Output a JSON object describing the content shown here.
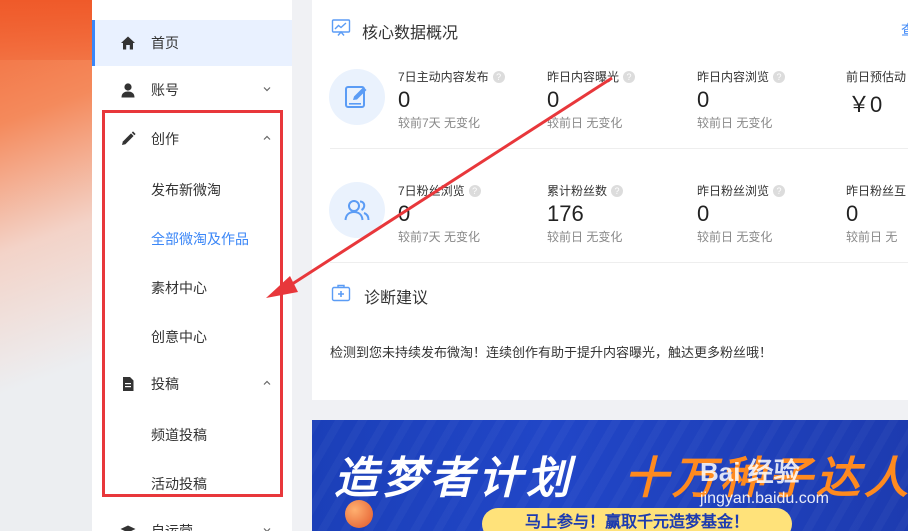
{
  "sidebar": {
    "items": [
      {
        "label": "首页",
        "icon": "home-icon",
        "active": true
      },
      {
        "label": "账号",
        "icon": "user-icon",
        "chevron": "down"
      },
      {
        "label": "创作",
        "icon": "pencil-icon",
        "chevron": "up"
      },
      {
        "label": "投稿",
        "icon": "document-icon",
        "chevron": "up"
      },
      {
        "label": "自运营",
        "icon": "graduation-cap-icon",
        "chevron": "down"
      }
    ],
    "create_sub": [
      "发布新微淘",
      "全部微淘及作品",
      "素材中心",
      "创意中心"
    ],
    "contribute_sub": [
      "频道投稿",
      "活动投稿"
    ],
    "selected_sub": "全部微淘及作品"
  },
  "core": {
    "title": "核心数据概况",
    "more": "查",
    "row1": [
      {
        "label": "7日主动内容发布",
        "value": "0",
        "sub": "较前7天 无变化"
      },
      {
        "label": "昨日内容曝光",
        "value": "0",
        "sub": "较前日 无变化"
      },
      {
        "label": "昨日内容浏览",
        "value": "0",
        "sub": "较前日 无变化"
      },
      {
        "label": "前日预估动",
        "value": "￥0",
        "sub": ""
      }
    ],
    "row2": [
      {
        "label": "7日粉丝浏览",
        "value": "0",
        "sub": "较前7天 无变化"
      },
      {
        "label": "累计粉丝数",
        "value": "176",
        "sub": "较前日 无变化"
      },
      {
        "label": "昨日粉丝浏览",
        "value": "0",
        "sub": "较前日 无变化"
      },
      {
        "label": "昨日粉丝互",
        "value": "0",
        "sub": "较前日 无"
      }
    ],
    "help": "?"
  },
  "advice": {
    "title": "诊断建议",
    "text": "检测到您未持续发布微淘！连续创作有助于提升内容曝光，触达更多粉丝哦！"
  },
  "banner": {
    "title_a": "造梦者计划",
    "title_b": "十万种子达人招",
    "pill": "马上参与！赢取千元造梦基金！"
  },
  "watermark": {
    "brand": "Bai 经验",
    "url": "jingyan.baidu.com"
  },
  "colors": {
    "accent": "#3a86f7",
    "highlight_box": "#e8373b",
    "banner_bg": "#1d3bb0",
    "banner_orange": "#ff8a1f"
  }
}
